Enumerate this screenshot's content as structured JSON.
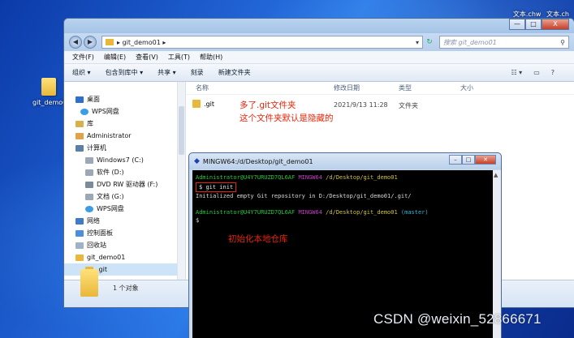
{
  "desktop": {
    "icon_label": "git_demo01",
    "top_files": [
      "文本.chw",
      "文本.ch"
    ]
  },
  "explorer": {
    "window_buttons": {
      "minimize": "—",
      "maximize": "□",
      "close": "X"
    },
    "address": {
      "crumb": "▸ git_demo01 ▸",
      "search_placeholder": "搜索 git_demo01"
    },
    "menu": [
      "文件(F)",
      "编辑(E)",
      "查看(V)",
      "工具(T)",
      "帮助(H)"
    ],
    "toolbar": [
      "组织 ▾",
      "包含到库中 ▾",
      "共享 ▾",
      "刻录",
      "新建文件夹"
    ],
    "columns": [
      "名称",
      "修改日期",
      "类型",
      "大小"
    ],
    "sidebar": [
      "桌面",
      "WPS网盘",
      "库",
      "Administrator",
      "计算机",
      "Windows7 (C:)",
      "软件 (D:)",
      "DVD RW 驱动器 (F:)",
      "文档 (G:)",
      "WPS网盘",
      "网络",
      "控制面板",
      "回收站",
      "git_demo01",
      ".git"
    ],
    "file": {
      "name": ".git",
      "date": "2021/9/13 11:28",
      "type": "文件夹"
    },
    "annotation_line1": "多了.git文件夹",
    "annotation_line2": "这个文件夹默认是隐藏的",
    "details_count": "1 个对象"
  },
  "terminal": {
    "title": "MINGW64:/d/Desktop/git_demo01",
    "prompt_user": "Administrator@U4Y7URUZD7QL6AF",
    "prompt_env": "MINGW64",
    "prompt_path": "/d/Desktop/git_demo01",
    "command": "git init",
    "output": "Initialized empty Git repository in D:/Desktop/git_demo01/.git/",
    "branch": "(master)",
    "dollar": "$",
    "annotation": "初始化本地仓库"
  },
  "watermark": "CSDN @weixin_52866671"
}
